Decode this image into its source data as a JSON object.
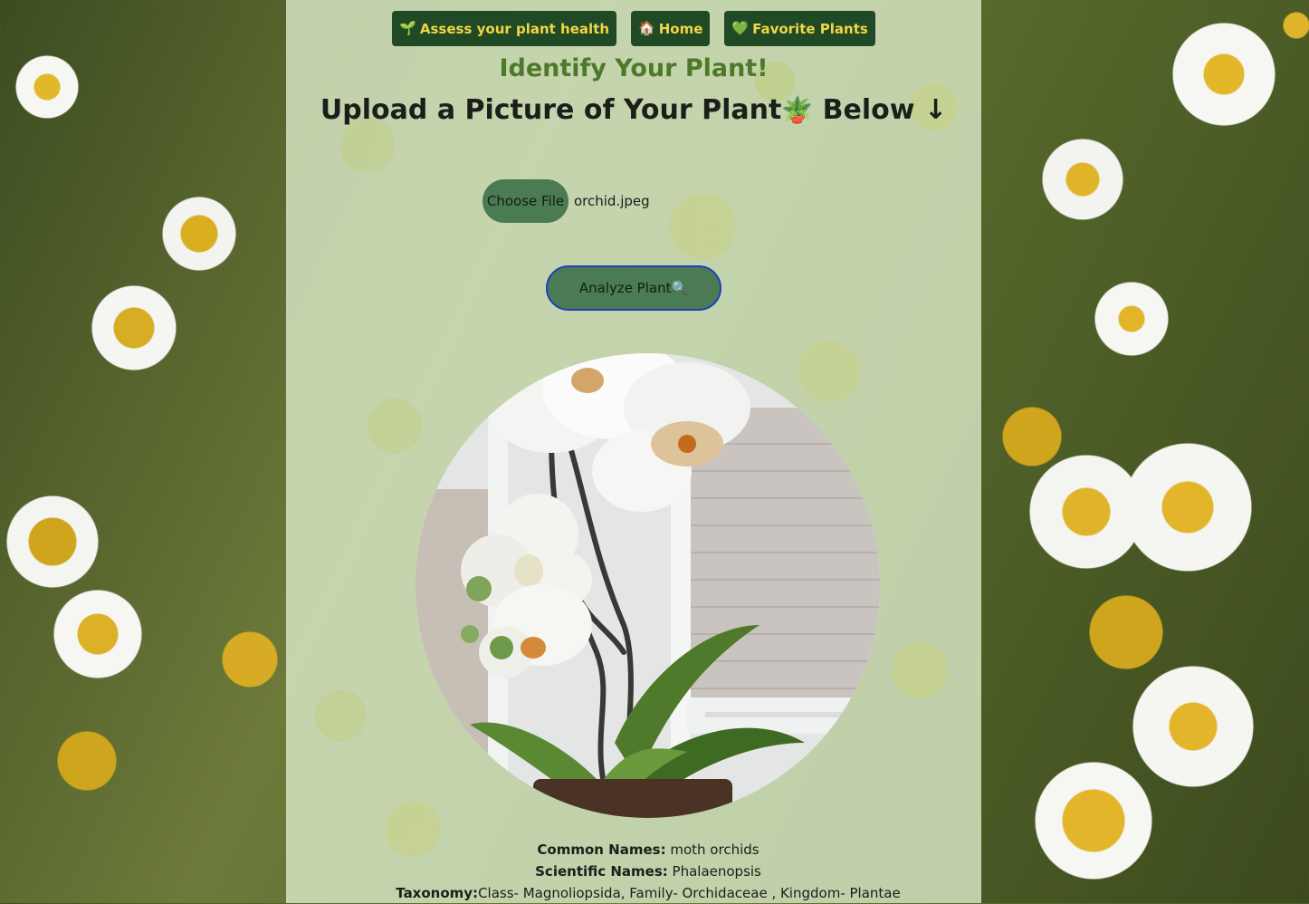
{
  "nav": {
    "items": [
      {
        "icon": "seedling-icon",
        "glyph": "🌱",
        "label": "Assess your plant health"
      },
      {
        "icon": "house-icon",
        "glyph": "🏠",
        "label": "Home"
      },
      {
        "icon": "green-heart-icon",
        "glyph": "💚",
        "label": "Favorite Plants"
      }
    ]
  },
  "main": {
    "title": "Identify Your Plant!",
    "subtitle_before": "Upload a Picture of Your Plant",
    "subtitle_icon": "🪴",
    "subtitle_after": " Below ↓"
  },
  "upload": {
    "choose_label": "Choose File",
    "file_name": "orchid.jpeg"
  },
  "analyze": {
    "label": "Analyze Plant",
    "icon": "🔍"
  },
  "result": {
    "image_alt": "orchid",
    "common_label": "Common Names:",
    "common_value": " moth orchids",
    "scientific_label": "Scientific Names:",
    "scientific_value": " Phalaenopsis",
    "taxonomy_label": "Taxonomy:",
    "taxonomy_value": "Class- Magnoliopsida, Family- Orchidaceae , Kingdom- Plantae"
  },
  "colors": {
    "nav_bg": "#1f4a25",
    "nav_text": "#f2d544",
    "title": "#4c7a2a",
    "button_green": "#4a7b52",
    "focus_border": "#1f3fbf",
    "panel": "#d6e6c4"
  }
}
